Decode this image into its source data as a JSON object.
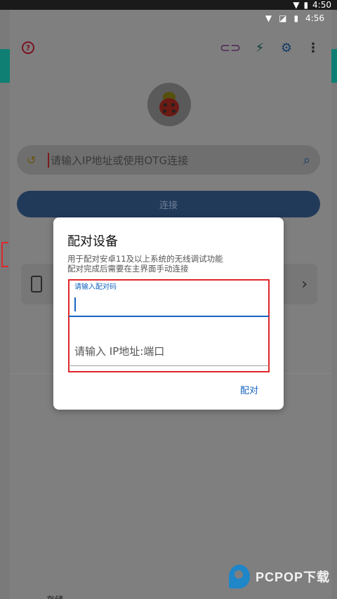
{
  "outer_status": {
    "time": "4:50"
  },
  "status": {
    "time": "4:56"
  },
  "toolbar": {
    "help_icon": "help-circle-icon",
    "link_icon": "link-icon",
    "flash_icon": "lightning-icon",
    "settings_icon": "gear-icon",
    "more_icon": "more-vert-icon"
  },
  "search": {
    "placeholder": "请输入IP地址或使用OTG连接",
    "history_icon": "history-icon",
    "search_icon": "search-icon"
  },
  "connect_button": {
    "label": "连接"
  },
  "bottom_fragment": "存储",
  "dialog": {
    "title": "配对设备",
    "message_line1": "用于配对安卓11及以上系统的无线调试功能",
    "message_line2": "配对完成后需要在主界面手动连接",
    "code_label": "请输入配对码",
    "code_value": "",
    "ip_placeholder": "请输入 IP地址:端口",
    "ip_value": "",
    "pair_button": "配对"
  },
  "watermark": {
    "text": "PCPOP下载"
  },
  "colors": {
    "accent_blue": "#1565c0",
    "highlight_red": "#e0262a",
    "teal": "#0f7f74"
  }
}
